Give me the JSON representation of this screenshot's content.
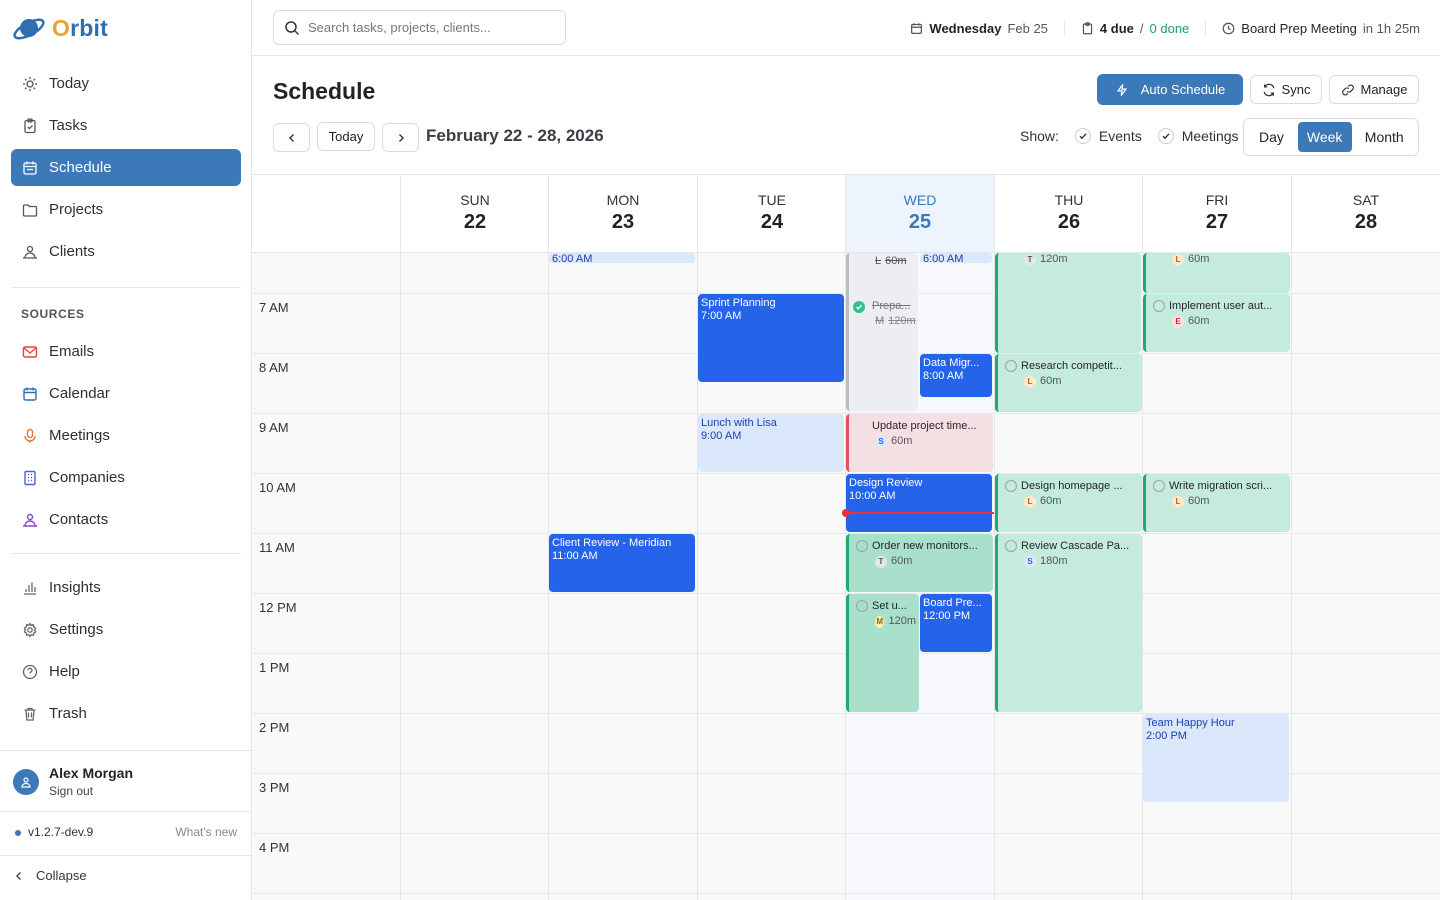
{
  "app": {
    "name_prefix": "",
    "name_o": "O",
    "name_rest": "rbit"
  },
  "sidebar": {
    "nav": [
      {
        "label": "Today",
        "icon": "sun-icon"
      },
      {
        "label": "Tasks",
        "icon": "clipboard-icon"
      },
      {
        "label": "Schedule",
        "icon": "calendar-icon"
      },
      {
        "label": "Projects",
        "icon": "folder-icon"
      },
      {
        "label": "Clients",
        "icon": "people-icon"
      }
    ],
    "sources_label": "SOURCES",
    "sources": [
      {
        "label": "Emails",
        "icon": "mail-icon"
      },
      {
        "label": "Calendar",
        "icon": "calendar-icon"
      },
      {
        "label": "Meetings",
        "icon": "mic-icon"
      },
      {
        "label": "Companies",
        "icon": "building-icon"
      },
      {
        "label": "Contacts",
        "icon": "contacts-icon"
      }
    ],
    "bottom": [
      {
        "label": "Insights",
        "icon": "chart-icon"
      },
      {
        "label": "Settings",
        "icon": "gear-icon"
      },
      {
        "label": "Help",
        "icon": "help-icon"
      },
      {
        "label": "Trash",
        "icon": "trash-icon"
      }
    ],
    "user": {
      "name": "Alex Morgan",
      "sign_out": "Sign out"
    },
    "version": "v1.2.7-dev.9",
    "whats_new": "What's new",
    "collapse": "Collapse"
  },
  "topbar": {
    "search_placeholder": "Search tasks, projects, clients...",
    "day": "Wednesday",
    "date": "Feb 25",
    "due": "4 due",
    "sep": "/",
    "done": "0 done",
    "next_meeting": "Board Prep Meeting",
    "next_in": "in 1h 25m"
  },
  "header": {
    "title": "Schedule",
    "auto_schedule": "Auto Schedule",
    "sync": "Sync",
    "manage": "Manage",
    "today": "Today",
    "range": "February 22 - 28, 2026",
    "show_label": "Show:",
    "events": "Events",
    "meetings": "Meetings",
    "views": [
      "Day",
      "Week",
      "Month"
    ],
    "active_view": "Week"
  },
  "calendar": {
    "days": [
      {
        "name": "SUN",
        "num": "22"
      },
      {
        "name": "MON",
        "num": "23"
      },
      {
        "name": "TUE",
        "num": "24"
      },
      {
        "name": "WED",
        "num": "25"
      },
      {
        "name": "THU",
        "num": "26"
      },
      {
        "name": "FRI",
        "num": "27"
      },
      {
        "name": "SAT",
        "num": "28"
      }
    ],
    "hours": [
      "7 AM",
      "8 AM",
      "9 AM",
      "10 AM",
      "11 AM",
      "12 PM",
      "1 PM",
      "2 PM",
      "3 PM",
      "4 PM"
    ],
    "events": {
      "mon_early": {
        "time": "6:00 AM"
      },
      "wed_early": {
        "time": "6:00 AM"
      },
      "wed_done_early": {
        "badge": "L",
        "dur": "60m"
      },
      "thu_early": {
        "badge": "T",
        "dur": "120m"
      },
      "fri_early": {
        "badge": "L",
        "dur": "60m"
      },
      "sprint": {
        "title": "Sprint Planning",
        "time": "7:00 AM"
      },
      "prep": {
        "title": "Prepa...",
        "badge": "M",
        "dur": "120m"
      },
      "impl": {
        "title": "Implement user aut...",
        "badge": "E",
        "dur": "60m"
      },
      "datamig": {
        "title": "Data Migr...",
        "time": "8:00 AM"
      },
      "research": {
        "title": "Research competit...",
        "badge": "L",
        "dur": "60m"
      },
      "lunch": {
        "title": "Lunch with Lisa",
        "time": "9:00 AM"
      },
      "update": {
        "title": "Update project time...",
        "badge": "S",
        "dur": "60m"
      },
      "design_review": {
        "title": "Design Review",
        "time": "10:00 AM"
      },
      "design_home": {
        "title": "Design homepage ...",
        "badge": "L",
        "dur": "60m"
      },
      "migration": {
        "title": "Write migration scri...",
        "badge": "L",
        "dur": "60m"
      },
      "client_review": {
        "title": "Client Review - Meridian",
        "time": "11:00 AM"
      },
      "monitors": {
        "title": "Order new monitors...",
        "badge": "T",
        "dur": "60m"
      },
      "cascade": {
        "title": "Review Cascade Pa...",
        "badge": "S",
        "dur": "180m"
      },
      "setup": {
        "title": "Set u...",
        "badge": "M",
        "dur": "120m"
      },
      "board": {
        "title": "Board Pre...",
        "time": "12:00 PM"
      },
      "happy": {
        "title": "Team Happy Hour",
        "time": "2:00 PM"
      }
    }
  }
}
